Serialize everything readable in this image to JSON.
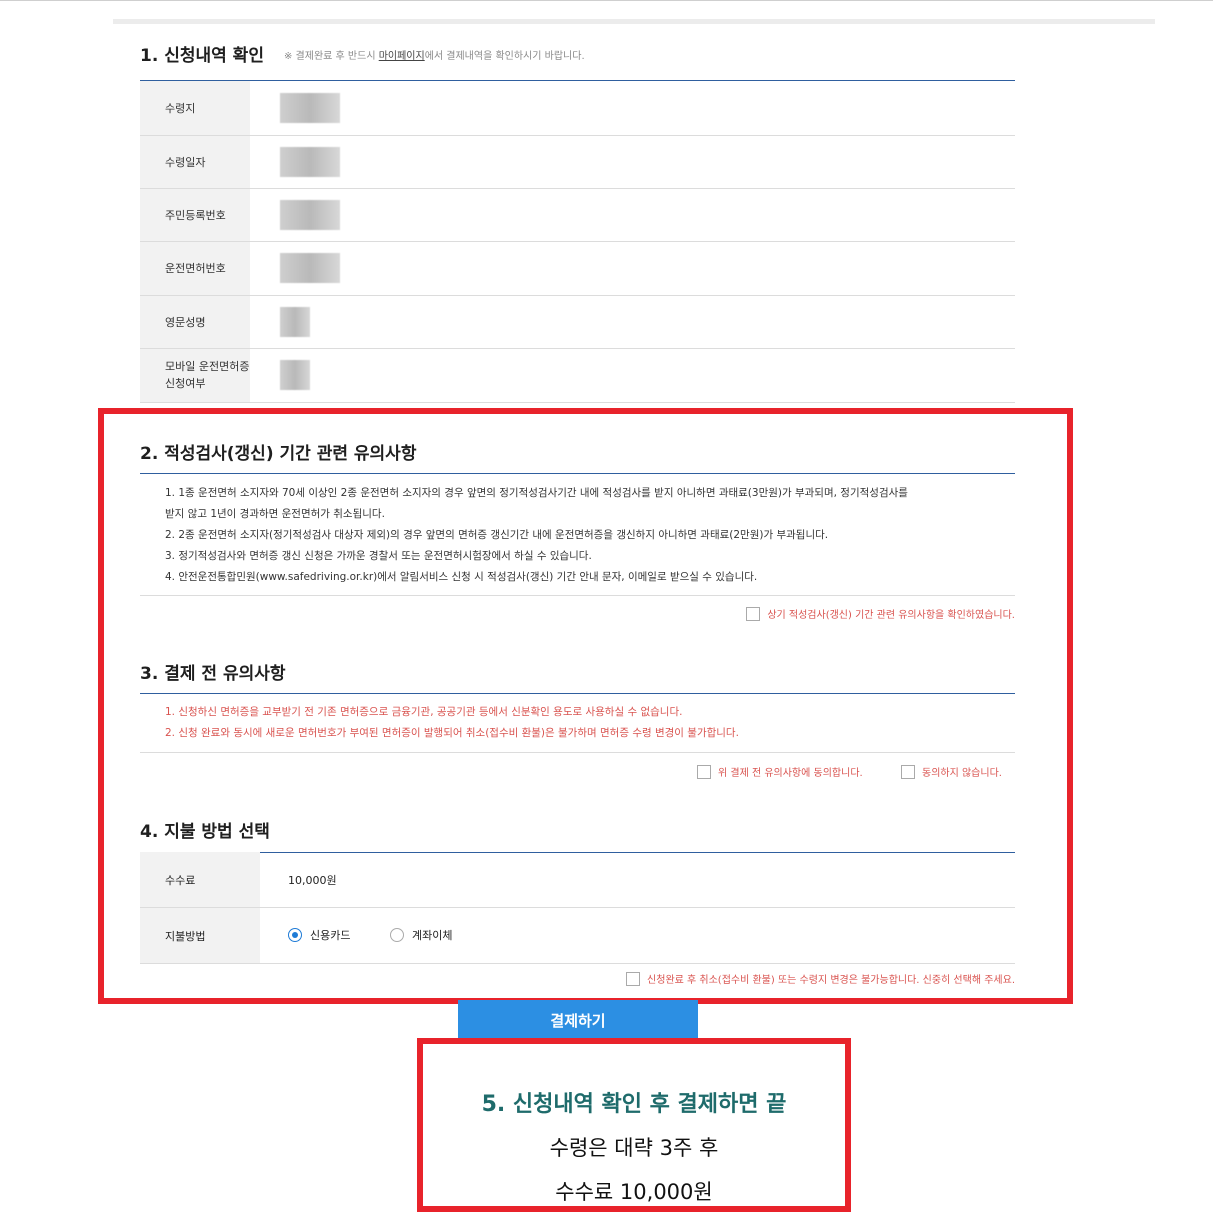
{
  "section1": {
    "title": "1. 신청내역 확인",
    "hint_prefix": "※ 결제완료 후 반드시 ",
    "hint_link": "마이페이지",
    "hint_suffix": "에서 결제내역을 확인하시기 바랍니다.",
    "rows": [
      {
        "label": "수령지"
      },
      {
        "label": "수령일자"
      },
      {
        "label": "주민등록번호"
      },
      {
        "label": "운전면허번호"
      },
      {
        "label": "영문성명"
      },
      {
        "label": "모바일 운전면허증 신청여부"
      }
    ]
  },
  "section2": {
    "title": "2. 적성검사(갱신) 기간 관련 유의사항",
    "notes": [
      "1. 1종 운전면허 소지자와 70세 이상인 2종 운전면허 소지자의 경우 앞면의 정기적성검사기간 내에 적성검사를 받지 아니하면 과태료(3만원)가 부과되며, 정기적성검사를",
      "받지 않고 1년이 경과하면 운전면허가 취소됩니다.",
      "2. 2종 운전면허 소지자(정기적성검사 대상자 제외)의 경우 앞면의 면허증 갱신기간 내에 운전면허증을 갱신하지 아니하면 과태료(2만원)가 부과됩니다.",
      "3. 정기적성검사와 면허증 갱신 신청은 가까운 경찰서 또는 운전면허시험장에서 하실 수 있습니다.",
      "4. 안전운전통합민원(www.safedriving.or.kr)에서 알림서비스 신청 시 적성검사(갱신) 기간 안내 문자, 이메일로 받으실 수 있습니다."
    ],
    "confirm": "상기 적성검사(갱신) 기간 관련 유의사항을 확인하였습니다."
  },
  "section3": {
    "title": "3. 결제 전 유의사항",
    "notes": [
      "1. 신청하신 면허증을 교부받기 전 기존 면허증으로 금융기관, 공공기관 등에서 신분확인 용도로 사용하실 수 없습니다.",
      "2. 신청 완료와 동시에 새로운 면허번호가 부여된 면허증이 발행되어 취소(접수비 환불)은 불가하며 면허증 수령 변경이 불가합니다."
    ],
    "agree": "위 결제 전 유의사항에 동의합니다.",
    "disagree": "동의하지 않습니다."
  },
  "section4": {
    "title": "4. 지불 방법 선택",
    "fee_label": "수수료",
    "fee_value": "10,000원",
    "method_label": "지불방법",
    "method_card": "신용카드",
    "method_transfer": "계좌이체",
    "notice": "신청완료 후 취소(접수비 환불) 또는 수령지 변경은 불가능합니다. 신중히 선택해 주세요."
  },
  "pay_button": "결제하기",
  "caption": {
    "line1": "5.  신청내역 확인 후 결제하면 끝",
    "line2": "수령은 대략 3주 후",
    "line3": "수수료 10,000원"
  },
  "colors": {
    "accent_red": "#e8232b",
    "button_blue": "#2c8fe3",
    "caption_teal": "#1e6b6b"
  }
}
